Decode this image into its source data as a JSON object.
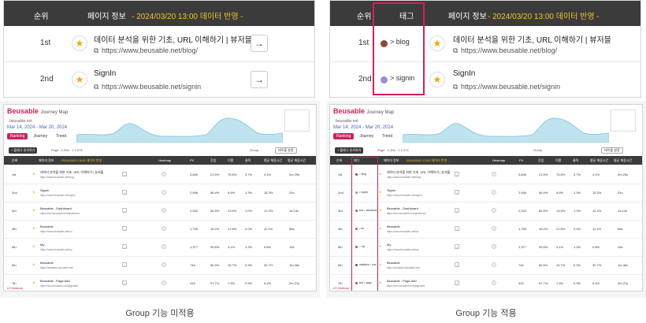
{
  "left": {
    "header": {
      "rank": "순위",
      "page_info": "페이지 정보",
      "notice": "- 2024/03/20 13:00 데이터 반영 -"
    },
    "rows": [
      {
        "rank": "1st",
        "title": "데이터 분석을 위한 기초, URL 이해하기 | 뷰저블",
        "url": "https://www.beusable.net/blog/"
      },
      {
        "rank": "2nd",
        "title": "SignIn",
        "url": "https://www.beusable.net/signin"
      }
    ],
    "caption": "Group 기능 미적용"
  },
  "right": {
    "header": {
      "rank": "순위",
      "tag": "태그",
      "page_info": "페이지 정보",
      "notice": "- 2024/03/20 13:00 데이터 반영 -"
    },
    "rows": [
      {
        "rank": "1st",
        "tag": "> blog",
        "tag_color": "#8b4a3c",
        "title": "데이터 분석을 위한 기초, URL 이해하기 | 뷰저블",
        "url": "https://www.beusable.net/blog/"
      },
      {
        "rank": "2nd",
        "tag": "> signin",
        "tag_color": "#9b8ae0",
        "title": "SignIn",
        "url": "https://www.beusable.net/signin"
      }
    ],
    "caption": "Group 기능 적용"
  },
  "app": {
    "logo": "Beusable",
    "logo_sub": "Journey Map",
    "domain": "beusable.net",
    "date_range": "Mar 14, 2024 - Mar 20, 2024",
    "tabs": [
      "Ranking",
      "Journey",
      "Trend"
    ],
    "add_button": "+ 플래그 추가하기",
    "toolbar_stats": "Page : 2,394   ·   1 1,074",
    "group_label": "Group",
    "view_setting": "테이블 설정",
    "table_header": {
      "rank": "순위",
      "tag": "태그",
      "page": "페이지 정보",
      "notice": "- 2024/03/20 13:00 데이터 반영 -",
      "heatmap": "Heatmap",
      "pv": "PV",
      "cols": [
        "진입",
        "이탈",
        "클릭",
        "평균 체류시간",
        "평균 체류시간"
      ]
    },
    "footer": "UX Heatmap",
    "rows": [
      {
        "rank": "1st",
        "title": "데이터 분석을 위한 기초, URL 이해하기 | 뷰저블",
        "url": "https://www.beusable.net/blog/",
        "pv": "3,846",
        "m1": "21.5%",
        "m2": "76.5%",
        "m3": "3.7%",
        "m4": "4.1%",
        "m5": "2m 25s",
        "tag": "> blog",
        "tag_color": "#8b4a3c"
      },
      {
        "rank": "2nd",
        "title": "SignIn",
        "url": "https://www.beusable.net/signin",
        "pv": "2,596",
        "m1": "56.4%",
        "m2": "9.6%",
        "m3": "1.3%",
        "m4": "15.3%",
        "m5": "31s",
        "tag": "> signin",
        "tag_color": "#9b8ae0"
      },
      {
        "rank": "3rd",
        "title": "Beusable - Dashboard",
        "url": "https://tool.beusable.net/dashboard",
        "pv": "2,020",
        "m1": "84.5%",
        "m2": "13.5%",
        "m3": "1.0%",
        "m4": "12.2%",
        "m5": "1d 14s",
        "tag": "tool > dashboard",
        "tag_color": "#c94a8a"
      },
      {
        "rank": "4th",
        "title": "Beusable",
        "url": "https://www.beusable.net/ko/",
        "pv": "1,795",
        "m1": "18.2%",
        "m2": "21.8%",
        "m3": "2.0%",
        "m4": "11.1%",
        "m5": "56s",
        "tag": "> ko",
        "tag_color": "#e0502a"
      },
      {
        "rank": "5th",
        "title": "My",
        "url": "https://www.beusable.net/my",
        "pv": "1,377",
        "m1": "99.5%",
        "m2": "3.1%",
        "m3": "1.3%",
        "m4": "0.8%",
        "m5": "15s",
        "tag": "> my",
        "tag_color": "#c94a4a"
      },
      {
        "rank": "6th",
        "title": "Beusable",
        "url": "https://analytics.beusable.net/",
        "pv": "745",
        "m1": "89.9%",
        "m2": "15.7%",
        "m3": "0.3%",
        "m4": "30.7%",
        "m5": "1m 46s",
        "tag": "analytics > root",
        "tag_color": "#555555"
      },
      {
        "rank": "7th",
        "title": "Beusable - Page Add",
        "url": "https://tool.beusable.net/page/add",
        "pv": "415",
        "m1": "97.7%",
        "m2": "7.5%",
        "m3": "0.9%",
        "m4": "5.4%",
        "m5": "2m 21s",
        "tag": "tool > page",
        "tag_color": "#e03a3a"
      }
    ]
  }
}
